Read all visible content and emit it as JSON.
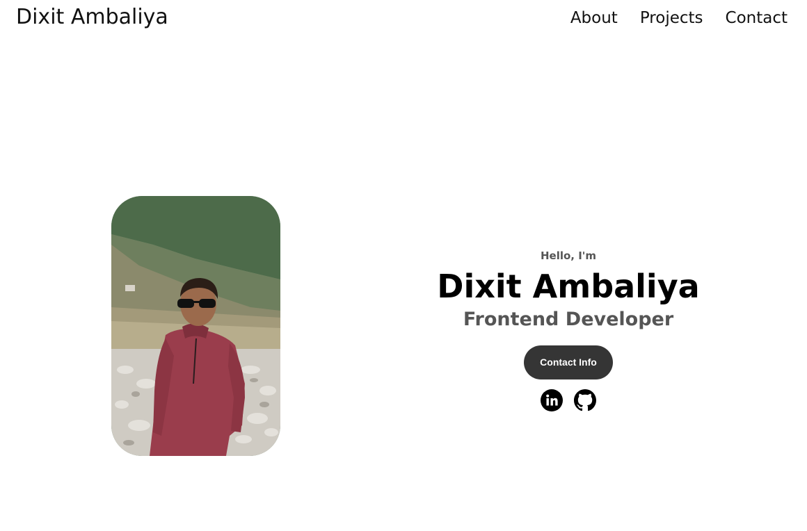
{
  "nav": {
    "logo": "Dixit Ambaliya",
    "links": [
      {
        "label": "About"
      },
      {
        "label": "Projects"
      },
      {
        "label": "Contact"
      }
    ]
  },
  "hero": {
    "greeting": "Hello, I'm",
    "name": "Dixit Ambaliya",
    "role": "Frontend Developer",
    "button_label": "Contact Info",
    "socials": [
      {
        "icon": "linkedin-icon"
      },
      {
        "icon": "github-icon"
      }
    ]
  },
  "colors": {
    "button_bg": "#353535",
    "text_muted": "#555555",
    "text_main": "#000000"
  }
}
